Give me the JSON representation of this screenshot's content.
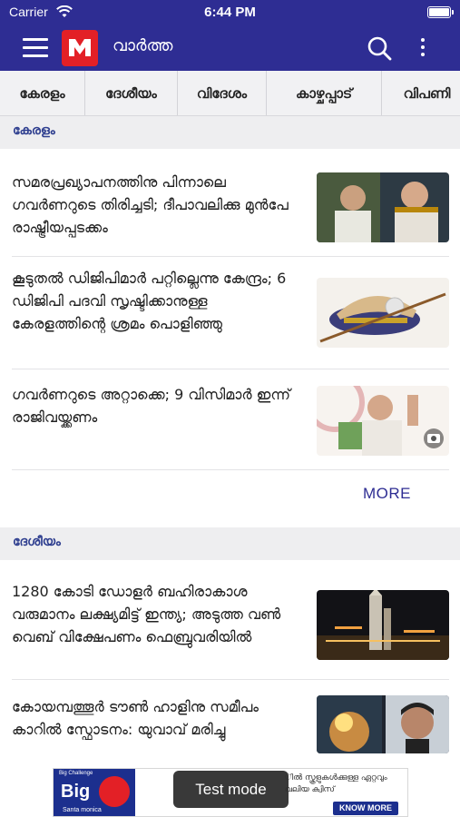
{
  "status_bar": {
    "carrier": "Carrier",
    "time": "6:44 PM"
  },
  "app_bar": {
    "logo_letter": "M",
    "title": "വാർത്ത"
  },
  "tabs": [
    {
      "label": "കേരളം"
    },
    {
      "label": "ദേശീയം"
    },
    {
      "label": "വിദേശം"
    },
    {
      "label": "കാഴ്ചപ്പാട്"
    },
    {
      "label": "വിപണി"
    }
  ],
  "sections": [
    {
      "label": "കേരളം",
      "stories": [
        {
          "headline": "സമരപ്രഖ്യാപനത്തിനു പിന്നാലെ ഗവർണറുടെ തിരിച്ചടി; ദീപാവലിക്കു മുൻപേ രാഷ്ട്രീയപ്പടക്കം"
        },
        {
          "headline": "കൂടുതൽ ഡിജിപിമാർ പറ്റില്ലെന്നു കേന്ദ്രം; 6 ഡിജിപി പദവി സൃഷ്ടിക്കാനുള്ള കേരളത്തിന്റെ ശ്രമം പൊളിഞ്ഞു"
        },
        {
          "headline": "ഗവർണറുടെ അറ്റാക്കെ; 9 വിസിമാർ ഇന്ന് രാജിവയ്ക്കണം"
        }
      ],
      "more_label": "MORE"
    },
    {
      "label": "ദേശീയം",
      "stories": [
        {
          "headline": "1280 കോടി ഡോളർ ബഹിരാകാശ വരുമാനം ലക്ഷ്യമിട്ട് ഇന്ത്യ; അടുത്ത വൺ വെബ് വിക്ഷേപണം ഫെബ്രുവരിയിൽ"
        },
        {
          "headline": "കോയമ്പത്തൂർ ടൗൺ ഹാളിനു സമീപം കാറിൽ സ്ഫോടനം: യുവാവ് മരിച്ചു"
        }
      ]
    }
  ],
  "ad": {
    "top_text": "Big Challenge",
    "big_text": "Big",
    "brand_text": "Santa monica",
    "tagline": "ിൽ സ്കൂളുകൾക്കുള്ള ഏറ്റവും വലിയ ക്വിസ്",
    "button_label": "KNOW MORE"
  },
  "toast": {
    "label": "Test mode"
  },
  "colors": {
    "primary": "#2e2d93",
    "logo_red": "#e32026",
    "section_text": "#2e3e8f"
  },
  "icons": {
    "menu": "hamburger-icon",
    "search": "search-icon",
    "more": "overflow-menu-icon",
    "wifi": "wifi-icon",
    "battery": "battery-icon",
    "camera": "camera-icon"
  }
}
